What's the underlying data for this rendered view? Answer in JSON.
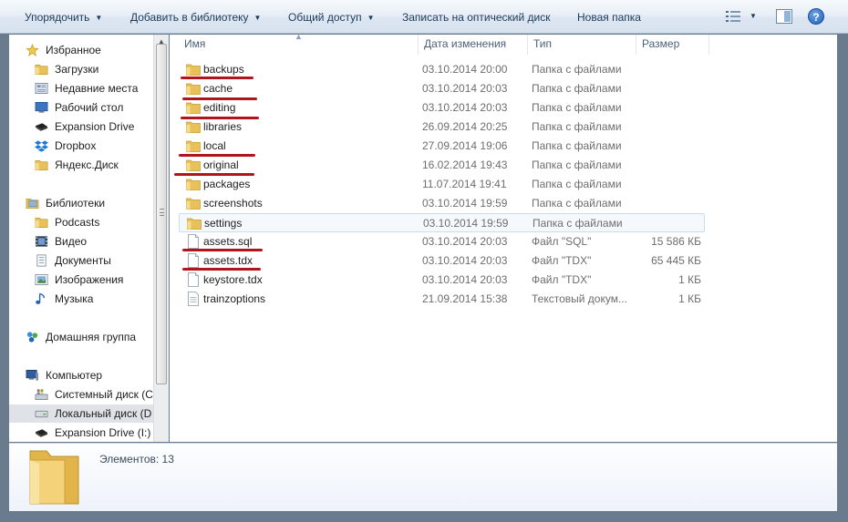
{
  "toolbar": {
    "organize": "Упорядочить",
    "add_to_library": "Добавить в библиотеку",
    "share": "Общий доступ",
    "burn": "Записать на оптический диск",
    "new_folder": "Новая папка",
    "help": "?"
  },
  "nav": {
    "favorites": "Избранное",
    "downloads": "Загрузки",
    "recent": "Недавние места",
    "desktop": "Рабочий стол",
    "expansion_drive": "Expansion Drive",
    "dropbox": "Dropbox",
    "yandex_disk": "Яндекс.Диск",
    "libraries": "Библиотеки",
    "podcasts": "Podcasts",
    "video": "Видео",
    "documents": "Документы",
    "images": "Изображения",
    "music": "Музыка",
    "homegroup": "Домашняя группа",
    "computer": "Компьютер",
    "system_disk": "Системный диск (C",
    "local_disk": "Локальный диск (D",
    "expansion_drive_i": "Expansion Drive (I:)"
  },
  "columns": {
    "name": "Имя",
    "date": "Дата изменения",
    "type": "Тип",
    "size": "Размер"
  },
  "files": [
    {
      "name": "backups",
      "date": "03.10.2014 20:00",
      "type": "Папка с файлами",
      "size": ""
    },
    {
      "name": "cache",
      "date": "03.10.2014 20:03",
      "type": "Папка с файлами",
      "size": ""
    },
    {
      "name": "editing",
      "date": "03.10.2014 20:03",
      "type": "Папка с файлами",
      "size": ""
    },
    {
      "name": "libraries",
      "date": "26.09.2014 20:25",
      "type": "Папка с файлами",
      "size": ""
    },
    {
      "name": "local",
      "date": "27.09.2014 19:06",
      "type": "Папка с файлами",
      "size": ""
    },
    {
      "name": "original",
      "date": "16.02.2014 19:43",
      "type": "Папка с файлами",
      "size": ""
    },
    {
      "name": "packages",
      "date": "11.07.2014 19:41",
      "type": "Папка с файлами",
      "size": ""
    },
    {
      "name": "screenshots",
      "date": "03.10.2014 19:59",
      "type": "Папка с файлами",
      "size": ""
    },
    {
      "name": "settings",
      "date": "03.10.2014 19:59",
      "type": "Папка с файлами",
      "size": ""
    },
    {
      "name": "assets.sql",
      "date": "03.10.2014 20:03",
      "type": "Файл \"SQL\"",
      "size": "15 586 КБ"
    },
    {
      "name": "assets.tdx",
      "date": "03.10.2014 20:03",
      "type": "Файл \"TDX\"",
      "size": "65 445 КБ"
    },
    {
      "name": "keystore.tdx",
      "date": "03.10.2014 20:03",
      "type": "Файл \"TDX\"",
      "size": "1 КБ"
    },
    {
      "name": "trainzoptions",
      "date": "21.09.2014 15:38",
      "type": "Текстовый докум...",
      "size": "1 КБ"
    }
  ],
  "details": {
    "count": "Элементов: 13"
  },
  "colors": {
    "annotation": "#b0141c",
    "folder": "#e8c15a",
    "toolbar_text": "#1e395b"
  }
}
